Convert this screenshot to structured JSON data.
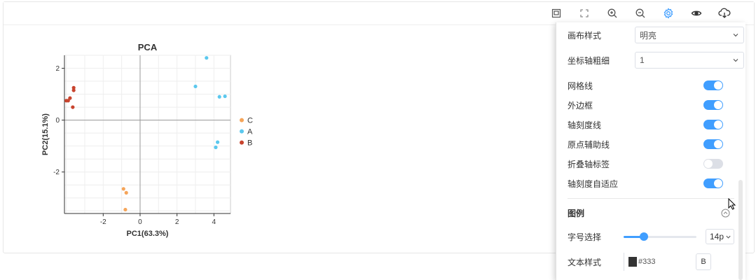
{
  "toolbar": {
    "icons": [
      "save-icon",
      "fullscreen-icon",
      "zoom-in-icon",
      "zoom-out-icon",
      "settings-icon",
      "eye-icon",
      "cloud-download-icon"
    ]
  },
  "chart_data": {
    "type": "scatter",
    "title": "PCA",
    "xlabel": "PC1(63.3%)",
    "ylabel": "PC2(15.1%)",
    "xlim": [
      -4.1,
      4.9
    ],
    "ylim": [
      -3.6,
      2.5
    ],
    "xticks": [
      -2,
      0,
      2,
      4
    ],
    "yticks": [
      -2,
      0,
      2
    ],
    "grid": true,
    "legend_position": "right",
    "series": [
      {
        "name": "C",
        "color": "#f5a55a",
        "points": [
          [
            -0.9,
            -2.65
          ],
          [
            -0.75,
            -2.8
          ],
          [
            -0.8,
            -3.45
          ]
        ]
      },
      {
        "name": "A",
        "color": "#5bc8ee",
        "points": [
          [
            3.6,
            2.4
          ],
          [
            3.0,
            1.3
          ],
          [
            4.3,
            0.9
          ],
          [
            4.6,
            0.92
          ],
          [
            4.2,
            -0.85
          ],
          [
            4.1,
            -1.05
          ]
        ]
      },
      {
        "name": "B",
        "color": "#c8442e",
        "points": [
          [
            -3.6,
            1.25
          ],
          [
            -3.6,
            1.15
          ],
          [
            -3.8,
            0.85
          ],
          [
            -3.9,
            0.75
          ],
          [
            -4.0,
            0.75
          ],
          [
            -3.65,
            0.5
          ]
        ]
      }
    ]
  },
  "panel": {
    "layout_style_label": "画布样式",
    "layout_style_value": "明亮",
    "axis_width_label": "坐标轴粗细",
    "axis_width_value": "1",
    "gridline_label": "网格线",
    "border_label": "外边框",
    "tick_line_label": "轴刻度线",
    "origin_line_label": "原点辅助线",
    "fold_axis_label": "折叠轴标签",
    "tick_adaptive_label": "轴刻度自适应",
    "legend_section": "图例",
    "font_size_label": "字号选择",
    "font_size_value": "14p",
    "text_style_label": "文本样式",
    "text_color_value": "#333",
    "bold_button": "B",
    "toggles": {
      "gridline": true,
      "border": true,
      "tick_line": true,
      "origin_line": true,
      "fold_axis": false,
      "tick_adaptive": true
    },
    "font_slider_fraction": 0.28,
    "accent": "#409eff"
  }
}
